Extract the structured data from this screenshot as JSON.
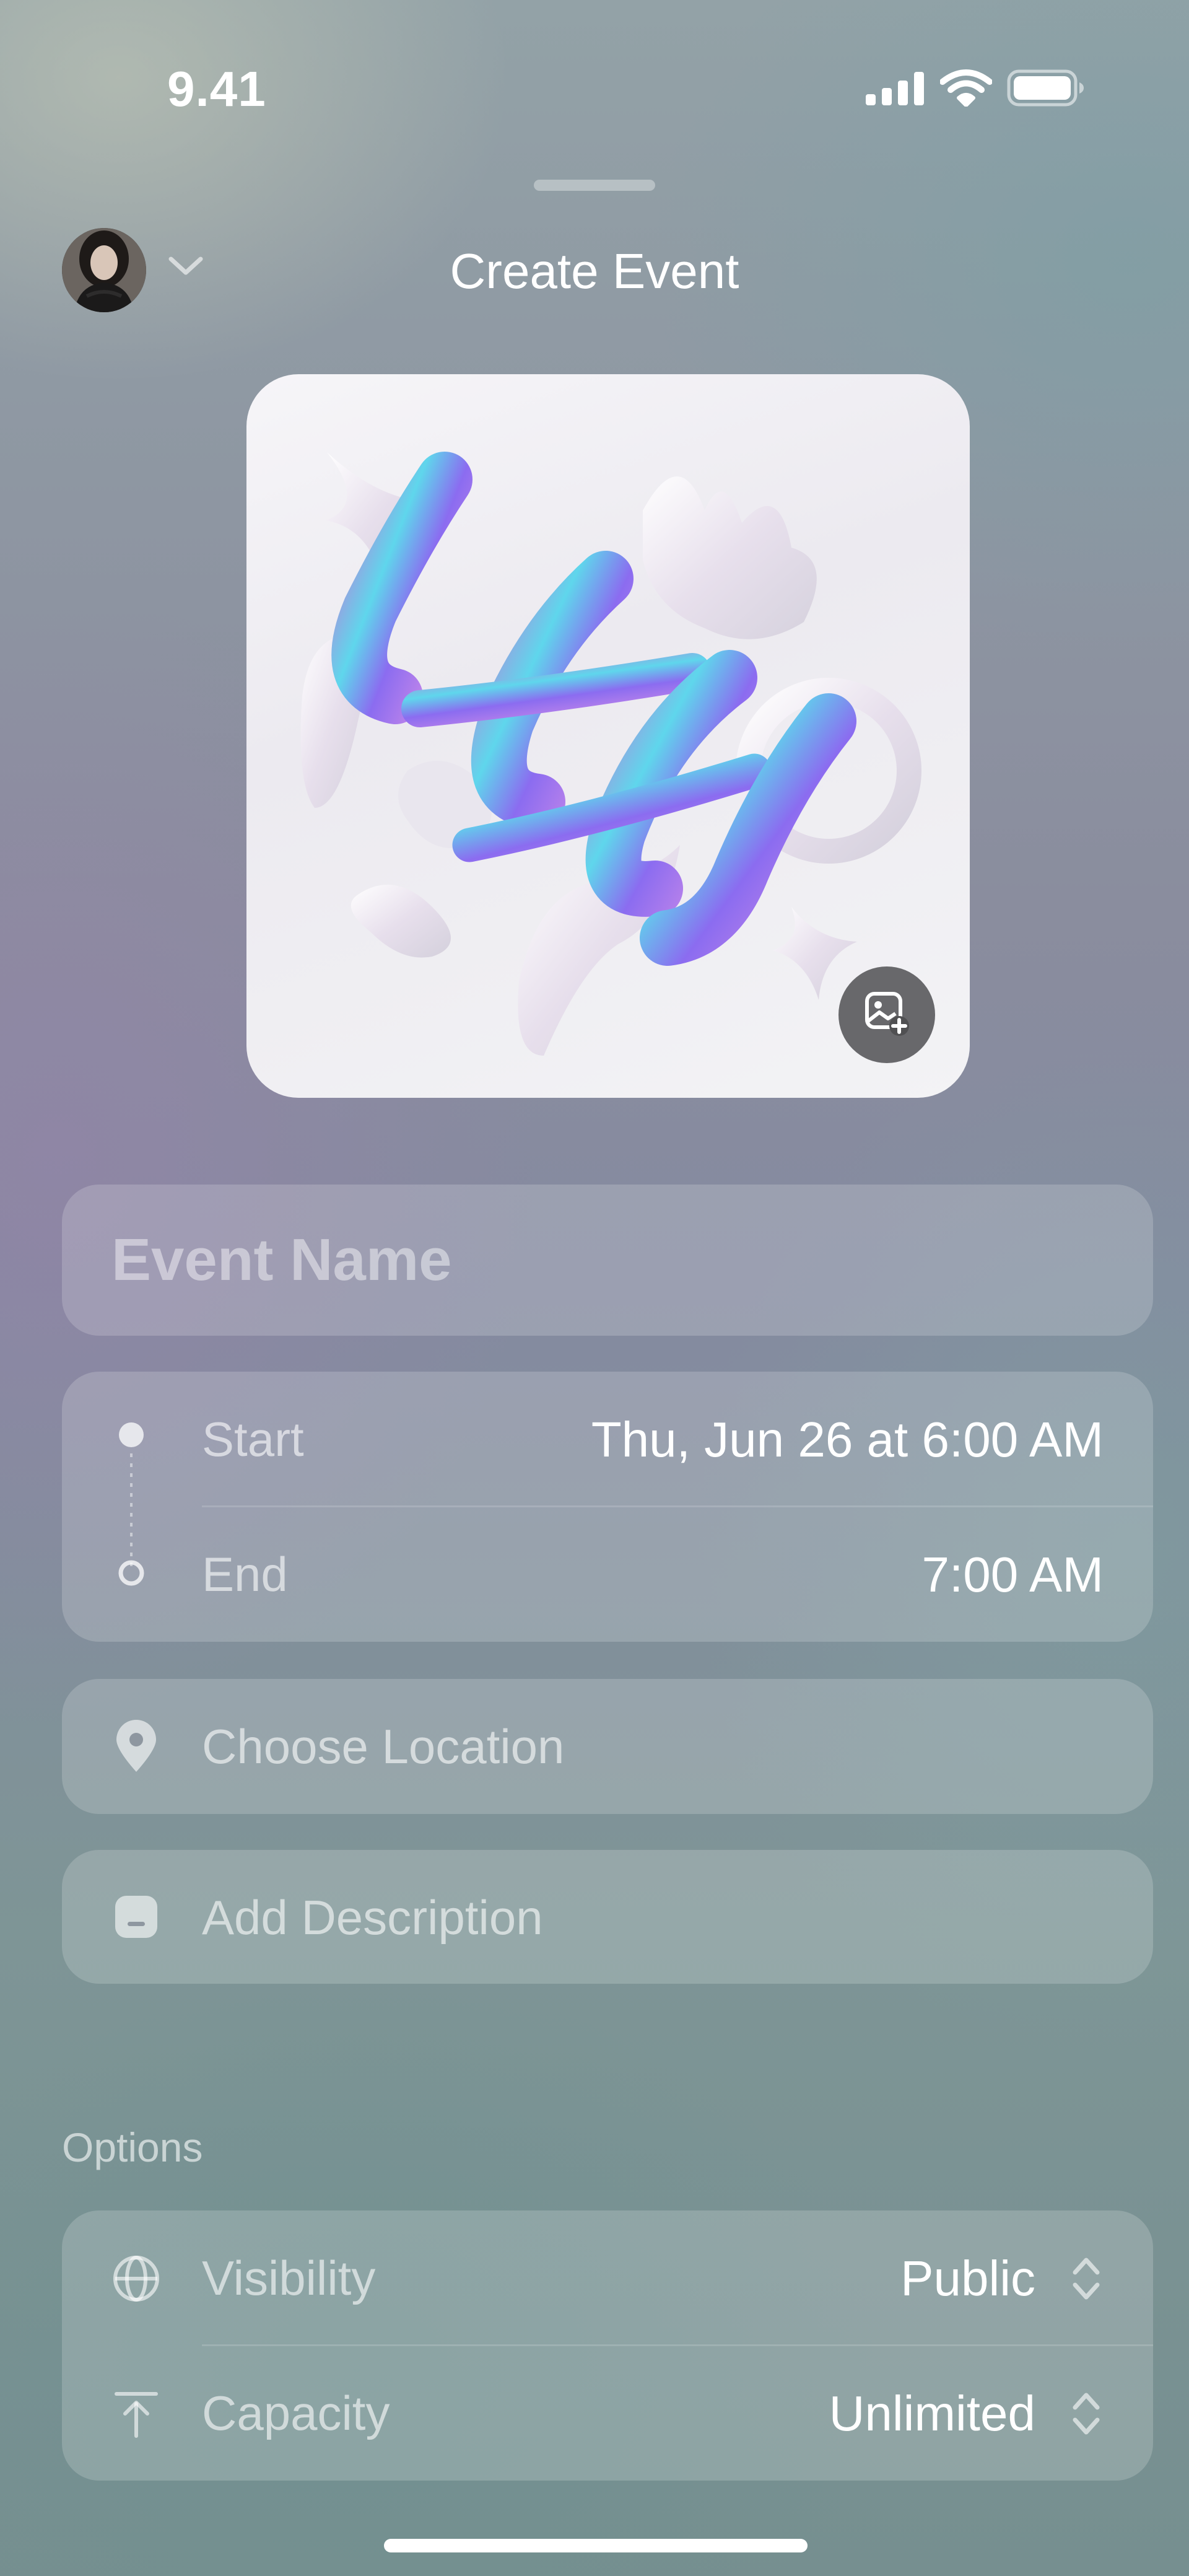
{
  "status_bar": {
    "time": "9.41",
    "icons": [
      "cellular-signal-icon",
      "wifi-icon",
      "battery-icon"
    ]
  },
  "header": {
    "title": "Create Event",
    "avatar": "avatar",
    "account_menu_icon": "chevron-down-icon"
  },
  "cover": {
    "description_icon": "add-photo-icon"
  },
  "event_name": {
    "placeholder": "Event Name"
  },
  "schedule": {
    "start_label": "Start",
    "start_value": "Thu, Jun 26 at 6:00 AM",
    "end_label": "End",
    "end_value": "7:00 AM"
  },
  "location": {
    "placeholder": "Choose Location",
    "icon": "location-pin-icon"
  },
  "description": {
    "placeholder": "Add Description",
    "icon": "note-icon"
  },
  "options": {
    "section_label": "Options",
    "visibility_label": "Visibility",
    "visibility_value": "Public",
    "visibility_icon": "globe-icon",
    "capacity_label": "Capacity",
    "capacity_value": "Unlimited",
    "capacity_icon": "capacity-icon"
  },
  "colors": {
    "text_primary": "#ffffff",
    "text_secondary": "rgba(255,255,255,0.6)",
    "card_background": "rgba(255,255,255,0.18)"
  }
}
